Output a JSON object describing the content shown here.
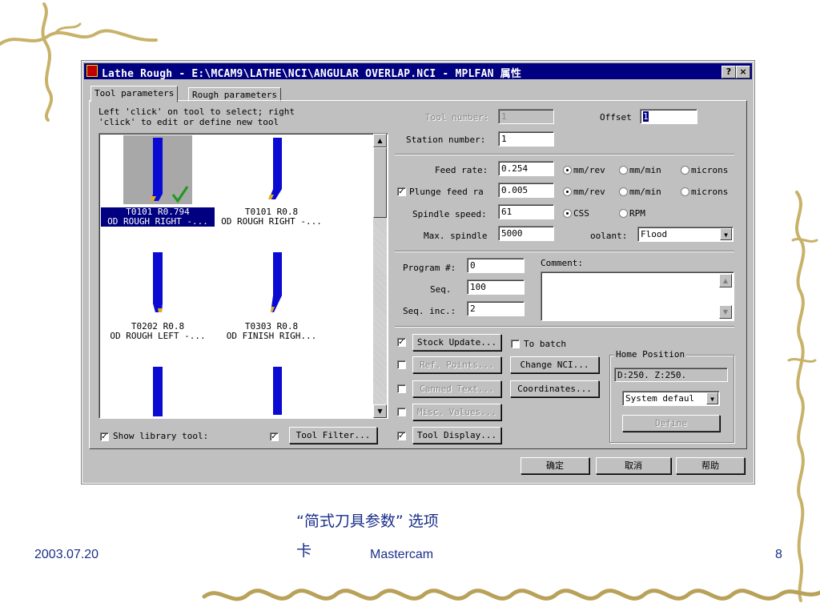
{
  "dialog": {
    "title": "Lathe Rough - E:\\MCAM9\\LATHE\\NCI\\ANGULAR OVERLAP.NCI - MPLFAN 属性",
    "help_btn": "?",
    "close_btn": "×",
    "tabs": [
      "Tool parameters",
      "Rough parameters"
    ],
    "instructions": [
      "Left 'click' on tool to select; right",
      "'click' to edit or define new tool"
    ],
    "tools": [
      {
        "code": "T0101 R0.794",
        "desc": "OD ROUGH RIGHT -...",
        "selected": true
      },
      {
        "code": "T0101 R0.8",
        "desc": "OD ROUGH RIGHT -...",
        "selected": false
      },
      {
        "code": "T0202 R0.8",
        "desc": "OD ROUGH LEFT -...",
        "selected": false
      },
      {
        "code": "T0303 R0.8",
        "desc": "OD FINISH RIGH...",
        "selected": false
      }
    ],
    "show_library": "Show library tool:",
    "tool_filter": "Tool Filter...",
    "tool_number_label": "Tool number:",
    "tool_number": "1",
    "offset_label": "Offset",
    "offset": "1",
    "station_label": "Station number:",
    "station": "1",
    "feed_rate_label": "Feed rate:",
    "feed_rate": "0.254",
    "plunge_label": "Plunge feed ra",
    "plunge": "0.005",
    "spindle_label": "Spindle speed:",
    "spindle": "61",
    "max_spindle_label": "Max. spindle",
    "max_spindle": "5000",
    "unit_mmrev": "mm/rev",
    "unit_mmmin": "mm/min",
    "unit_microns": "microns",
    "css": "CSS",
    "rpm": "RPM",
    "coolant_label": "oolant:",
    "coolant": "Flood",
    "program_label": "Program #:",
    "program": "0",
    "seq_label": "Seq.",
    "seq": "100",
    "seqinc_label": "Seq. inc.:",
    "seqinc": "2",
    "comment_label": "Comment:",
    "stock_update": "Stock Update...",
    "to_batch": "To batch",
    "ref_points": "Ref. Points...",
    "change_nci": "Change NCI...",
    "canned_text": "Canned Text...",
    "coordinates": "Coordinates...",
    "misc_values": "Misc. Values...",
    "tool_display": "Tool Display...",
    "home_title": "Home Position",
    "home_value": "D:250.  Z:250.",
    "home_select": "System defaul",
    "define": "Define",
    "ok": "确定",
    "cancel": "取消",
    "help": "帮助"
  },
  "slide": {
    "caption_line1": "“简式刀具参数” 选项",
    "caption_line2": "卡",
    "date": "2003.07.20",
    "product": "Mastercam",
    "page": "8"
  },
  "colors": {
    "title_bar": "#000080",
    "tool_blue": "#0a0ad2",
    "tool_tip": "#e0b020",
    "check": "#1a9a1a",
    "footer_text": "#1a2f8a",
    "vine": "#c8b26a"
  }
}
